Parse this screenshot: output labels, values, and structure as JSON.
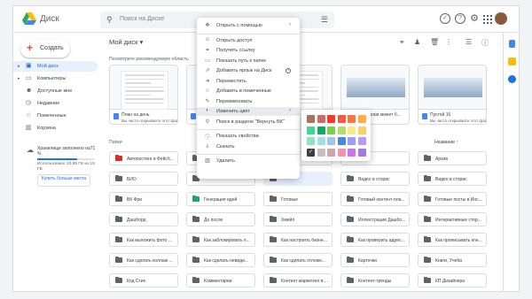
{
  "header": {
    "app_name": "Диск",
    "search_placeholder": "Поиск на Диске"
  },
  "sidebar": {
    "create_label": "Создать",
    "items": [
      {
        "label": "Мой диск",
        "icon": "my-drive-icon",
        "active": true
      },
      {
        "label": "Компьютеры",
        "icon": "computer-icon",
        "active": false
      },
      {
        "label": "Доступные мне",
        "icon": "shared-icon",
        "active": false
      },
      {
        "label": "Недавние",
        "icon": "clock-icon",
        "active": false
      },
      {
        "label": "Помеченные",
        "icon": "star-icon",
        "active": false
      },
      {
        "label": "Корзина",
        "icon": "trash-icon",
        "active": false
      }
    ],
    "storage_title": "Хранилище заполнено на71 %",
    "storage_used": "Использовано 10,69 ГБ из 15 ГБ",
    "storage_percent": 71,
    "buy_label": "Купить больше места"
  },
  "main": {
    "title": "Мой диск",
    "suggested_title": "Посмотрите рекомендуемую область",
    "cards": [
      {
        "name": "План на день",
        "sub": "Вы часто открываете этот файл",
        "thumb": "doc"
      },
      {
        "name": "",
        "sub": "",
        "thumb": "doc"
      },
      {
        "name": "",
        "sub": "",
        "thumb": "doc"
      },
      {
        "name": "Чем Sarsotat может б...",
        "sub": "",
        "thumb": "photo"
      },
      {
        "name": "Пустой 16",
        "sub": "Вы часто открываете этот файл",
        "thumb": "photo"
      }
    ],
    "folders_label": "Папки",
    "sort_label": "Название",
    "folders": [
      [
        "Автопостинг в Фейсб...",
        "",
        "",
        "",
        "Архив"
      ],
      [
        "БИО",
        "",
        "",
        "Видео в сторис",
        "Видео в сторис"
      ],
      [
        "ВК Фри",
        "Генерация идей",
        "Готовые",
        "Готовый контент-пла...",
        "Готовые посты в Инс..."
      ],
      [
        "Дашборд",
        "До после",
        "Хмейл",
        "Иллюстрации Дашбо...",
        "Интерактивные стор..."
      ],
      [
        "Как выложить фото ...",
        "Как заблокировать п...",
        "Как настроить бизне...",
        "Как проверить адрес...",
        "Как прописывать кле..."
      ],
      [
        "Как сделать коллаж ...",
        "Как сделать невиди...",
        "Как сделать отложе...",
        "Карточки",
        "Книги, Учеба"
      ],
      [
        "Код Стик",
        "Комментарии",
        "Контент маркетинг в ...",
        "Контент-тренды",
        "КП Дизайнера"
      ]
    ]
  },
  "context_menu": {
    "items": [
      {
        "label": "Открыть с помощью",
        "icon": "move-icon",
        "arrow": true
      },
      {
        "sep": true
      },
      {
        "label": "Открыть доступ",
        "icon": "add-person-icon"
      },
      {
        "label": "Получить ссылку",
        "icon": "link-icon"
      },
      {
        "label": "Показать путь к папке",
        "icon": "folder-icon"
      },
      {
        "label": "Добавить ярлык на Диск",
        "icon": "shortcut-icon",
        "help": true
      },
      {
        "label": "Переместить",
        "icon": "move-to-icon"
      },
      {
        "label": "Добавить в помеченные",
        "icon": "star-icon"
      },
      {
        "label": "Переименовать",
        "icon": "edit-icon"
      },
      {
        "label": "Изменить цвет",
        "icon": "palette-icon",
        "arrow": true,
        "highlight": true
      },
      {
        "label": "Поиск в разделе \"Вернуть ВК\"",
        "icon": "search-icon"
      },
      {
        "sep": true
      },
      {
        "label": "Показать свойства",
        "icon": "info-icon"
      },
      {
        "label": "Скачать",
        "icon": "download-icon"
      },
      {
        "sep": true
      },
      {
        "label": "Удалить",
        "icon": "trash-icon"
      }
    ]
  },
  "palette_colors": [
    [
      "#ac725e",
      "#d06b64",
      "#f83a22",
      "#fa573c",
      "#ff7537",
      "#ffad46"
    ],
    [
      "#42d692",
      "#16a765",
      "#7bd148",
      "#b3dc6c",
      "#fbe983",
      "#fad165"
    ],
    [
      "#92e1c0",
      "#9fe1e7",
      "#9fc6e7",
      "#4986e7",
      "#9a9cff",
      "#b99aff"
    ],
    [
      "#8f8f8f",
      "#cabdbf",
      "#cca6ac",
      "#f691b2",
      "#cd74e6",
      "#a47ae2"
    ]
  ],
  "accent": "#1a73e8"
}
